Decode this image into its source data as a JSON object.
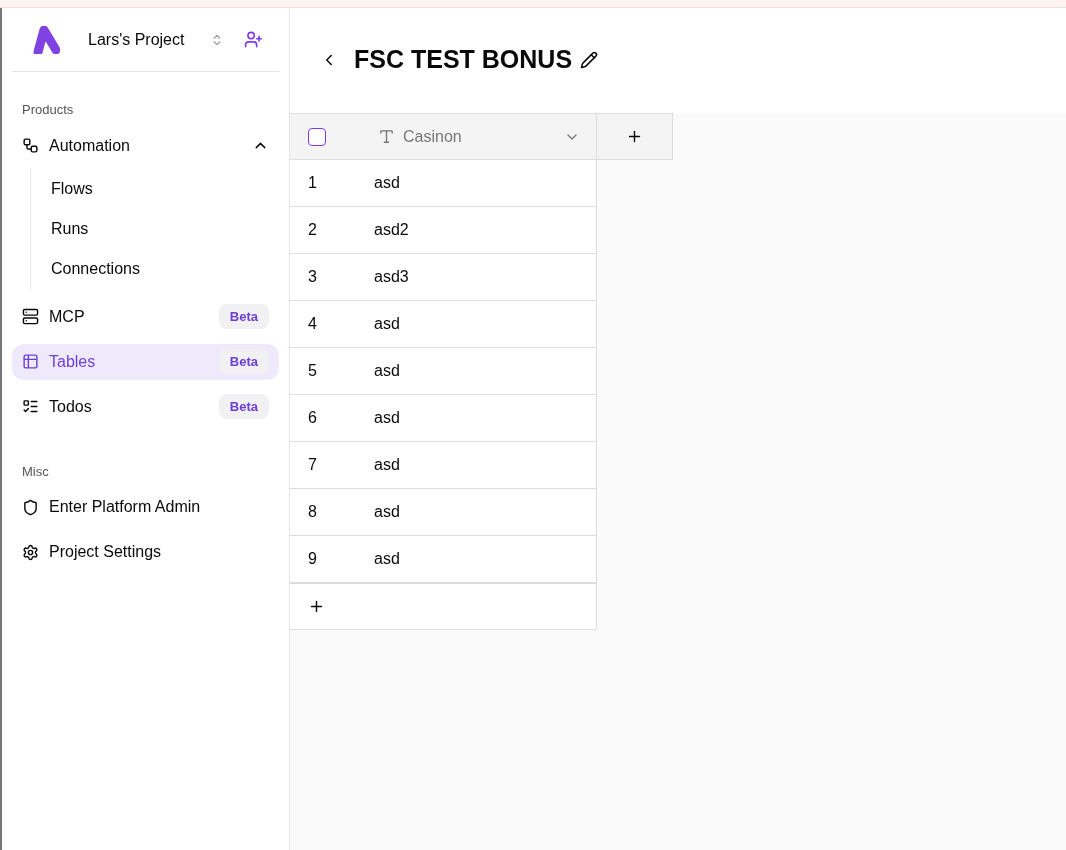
{
  "project": {
    "name": "Lars's Project"
  },
  "sections": [
    {
      "label": "Products",
      "items": [
        {
          "label": "Automation",
          "selected": false,
          "expanded": true,
          "children": [
            {
              "label": "Flows"
            },
            {
              "label": "Runs"
            },
            {
              "label": "Connections"
            }
          ]
        },
        {
          "label": "MCP",
          "selected": false,
          "badge": "Beta"
        },
        {
          "label": "Tables",
          "selected": true,
          "badge": "Beta"
        },
        {
          "label": "Todos",
          "selected": false,
          "badge": "Beta"
        }
      ]
    },
    {
      "label": "Misc",
      "items": [
        {
          "label": "Enter Platform Admin",
          "selected": false
        },
        {
          "label": "Project Settings",
          "selected": false
        }
      ]
    }
  ],
  "page": {
    "title": "FSC TEST BONUS"
  },
  "table": {
    "header_checked": false,
    "columns": [
      {
        "name": "Casinon"
      }
    ],
    "rows": [
      {
        "index": "1",
        "cells": [
          "asd"
        ]
      },
      {
        "index": "2",
        "cells": [
          "asd2"
        ]
      },
      {
        "index": "3",
        "cells": [
          "asd3"
        ]
      },
      {
        "index": "4",
        "cells": [
          "asd"
        ]
      },
      {
        "index": "5",
        "cells": [
          "asd"
        ]
      },
      {
        "index": "6",
        "cells": [
          "asd"
        ]
      },
      {
        "index": "7",
        "cells": [
          "asd"
        ]
      },
      {
        "index": "8",
        "cells": [
          "asd"
        ]
      },
      {
        "index": "9",
        "cells": [
          "asd"
        ]
      }
    ]
  }
}
